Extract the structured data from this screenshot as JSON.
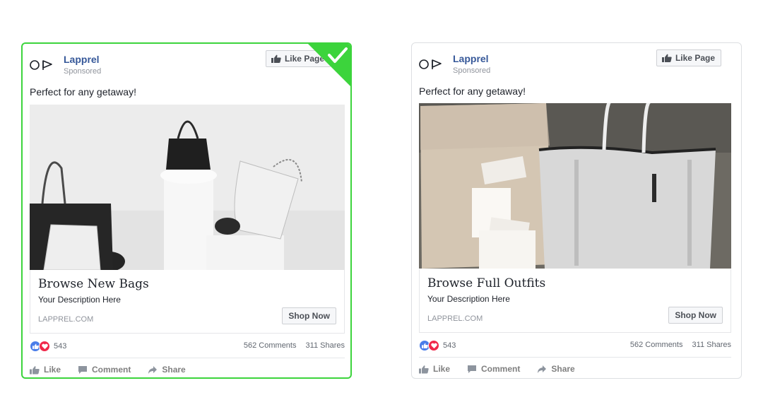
{
  "ads": [
    {
      "page_name": "Lapprel",
      "sponsored": "Sponsored",
      "like_page": "Like Page",
      "message": "Perfect for any getaway!",
      "headline": "Browse New Bags",
      "description": "Your Description Here",
      "domain": "LAPPREL.COM",
      "cta": "Shop Now",
      "reaction_count": "543",
      "comments": "562 Comments",
      "shares": "311 Shares",
      "action_like": "Like",
      "action_comment": "Comment",
      "action_share": "Share",
      "selected": true
    },
    {
      "page_name": "Lapprel",
      "sponsored": "Sponsored",
      "like_page": "Like Page",
      "message": "Perfect for any getaway!",
      "headline": "Browse Full Outfits",
      "description": "Your Description Here",
      "domain": "LAPPREL.COM",
      "cta": "Shop Now",
      "reaction_count": "543",
      "comments": "562 Comments",
      "shares": "311 Shares",
      "action_like": "Like",
      "action_comment": "Comment",
      "action_share": "Share",
      "selected": false
    }
  ],
  "colors": {
    "selected_border": "#3cd43c",
    "page_name": "#365899",
    "like_reaction": "#4a7de9",
    "love_reaction": "#f0284a"
  }
}
